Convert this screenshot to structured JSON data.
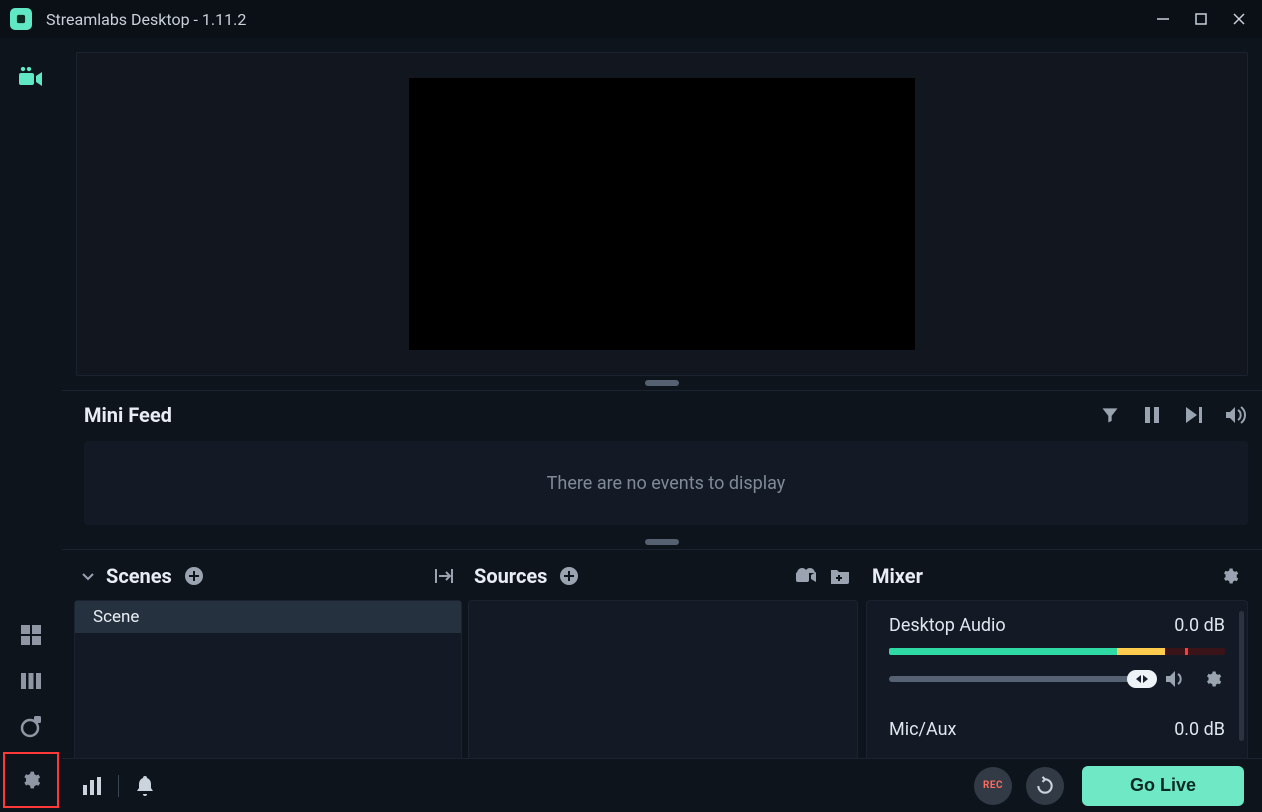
{
  "titlebar": {
    "title": "Streamlabs Desktop - 1.11.2"
  },
  "minifeed": {
    "title": "Mini Feed",
    "empty_text": "There are no events to display"
  },
  "scenes": {
    "title": "Scenes",
    "items": [
      "Scene"
    ]
  },
  "sources": {
    "title": "Sources"
  },
  "mixer": {
    "title": "Mixer",
    "channels": [
      {
        "name": "Desktop Audio",
        "db": "0.0 dB"
      },
      {
        "name": "Mic/Aux",
        "db": "0.0 dB"
      }
    ]
  },
  "footer": {
    "rec_label": "REC",
    "golive_label": "Go Live"
  }
}
